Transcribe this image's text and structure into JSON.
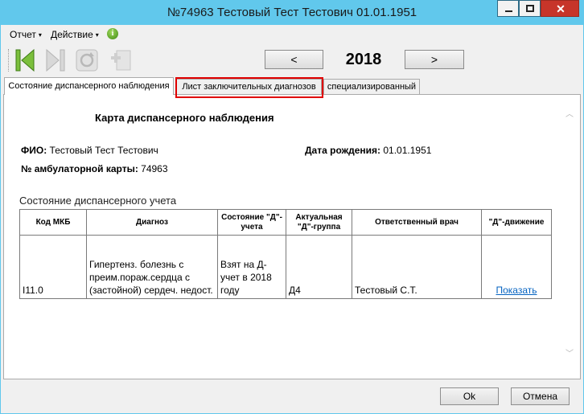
{
  "window": {
    "title": "№74963 Тестовый Тест Тестович 01.01.1951",
    "close_glyph": "✕"
  },
  "menu": {
    "report": "Отчет",
    "action": "Действие",
    "arrow": "▾",
    "info_glyph": "i"
  },
  "toolbar": {
    "year": "2018",
    "prev_label": "<",
    "next_label": ">"
  },
  "tabs": [
    {
      "label": "Состояние диспансерного наблюдения",
      "active": true
    },
    {
      "label": "Лист заключительных диагнозов",
      "active": false
    },
    {
      "label": "специализированный",
      "active": false
    }
  ],
  "document": {
    "title": "Карта диспансерного наблюдения",
    "fio_label": "ФИО:",
    "fio_value": "Тестовый Тест Тестович",
    "dob_label": "Дата рождения:",
    "dob_value": "01.01.1951",
    "card_label": "№ амбулаторной карты:",
    "card_value": "74963",
    "section_title": "Состояние диспансерного учета"
  },
  "table": {
    "headers": [
      "Код МКБ",
      "Диагноз",
      "Состояние \"Д\"-учета",
      "Актуальная \"Д\"-группа",
      "Ответственный врач",
      "\"Д\"-движение"
    ],
    "rows": [
      {
        "code": "I11.0",
        "diagnosis": "Гипертенз. болезнь с преим.пораж.сердца с (застойной) сердеч. недост.",
        "status": "Взят на Д-учет в 2018 году",
        "group": "Д4",
        "doctor": "Тестовый С.Т.",
        "movement": "Показать"
      }
    ]
  },
  "buttons": {
    "ok": "Ok",
    "cancel": "Отмена"
  },
  "colors": {
    "titlebar": "#61c8ec",
    "highlight": "#e00000",
    "link": "#0563c1"
  }
}
